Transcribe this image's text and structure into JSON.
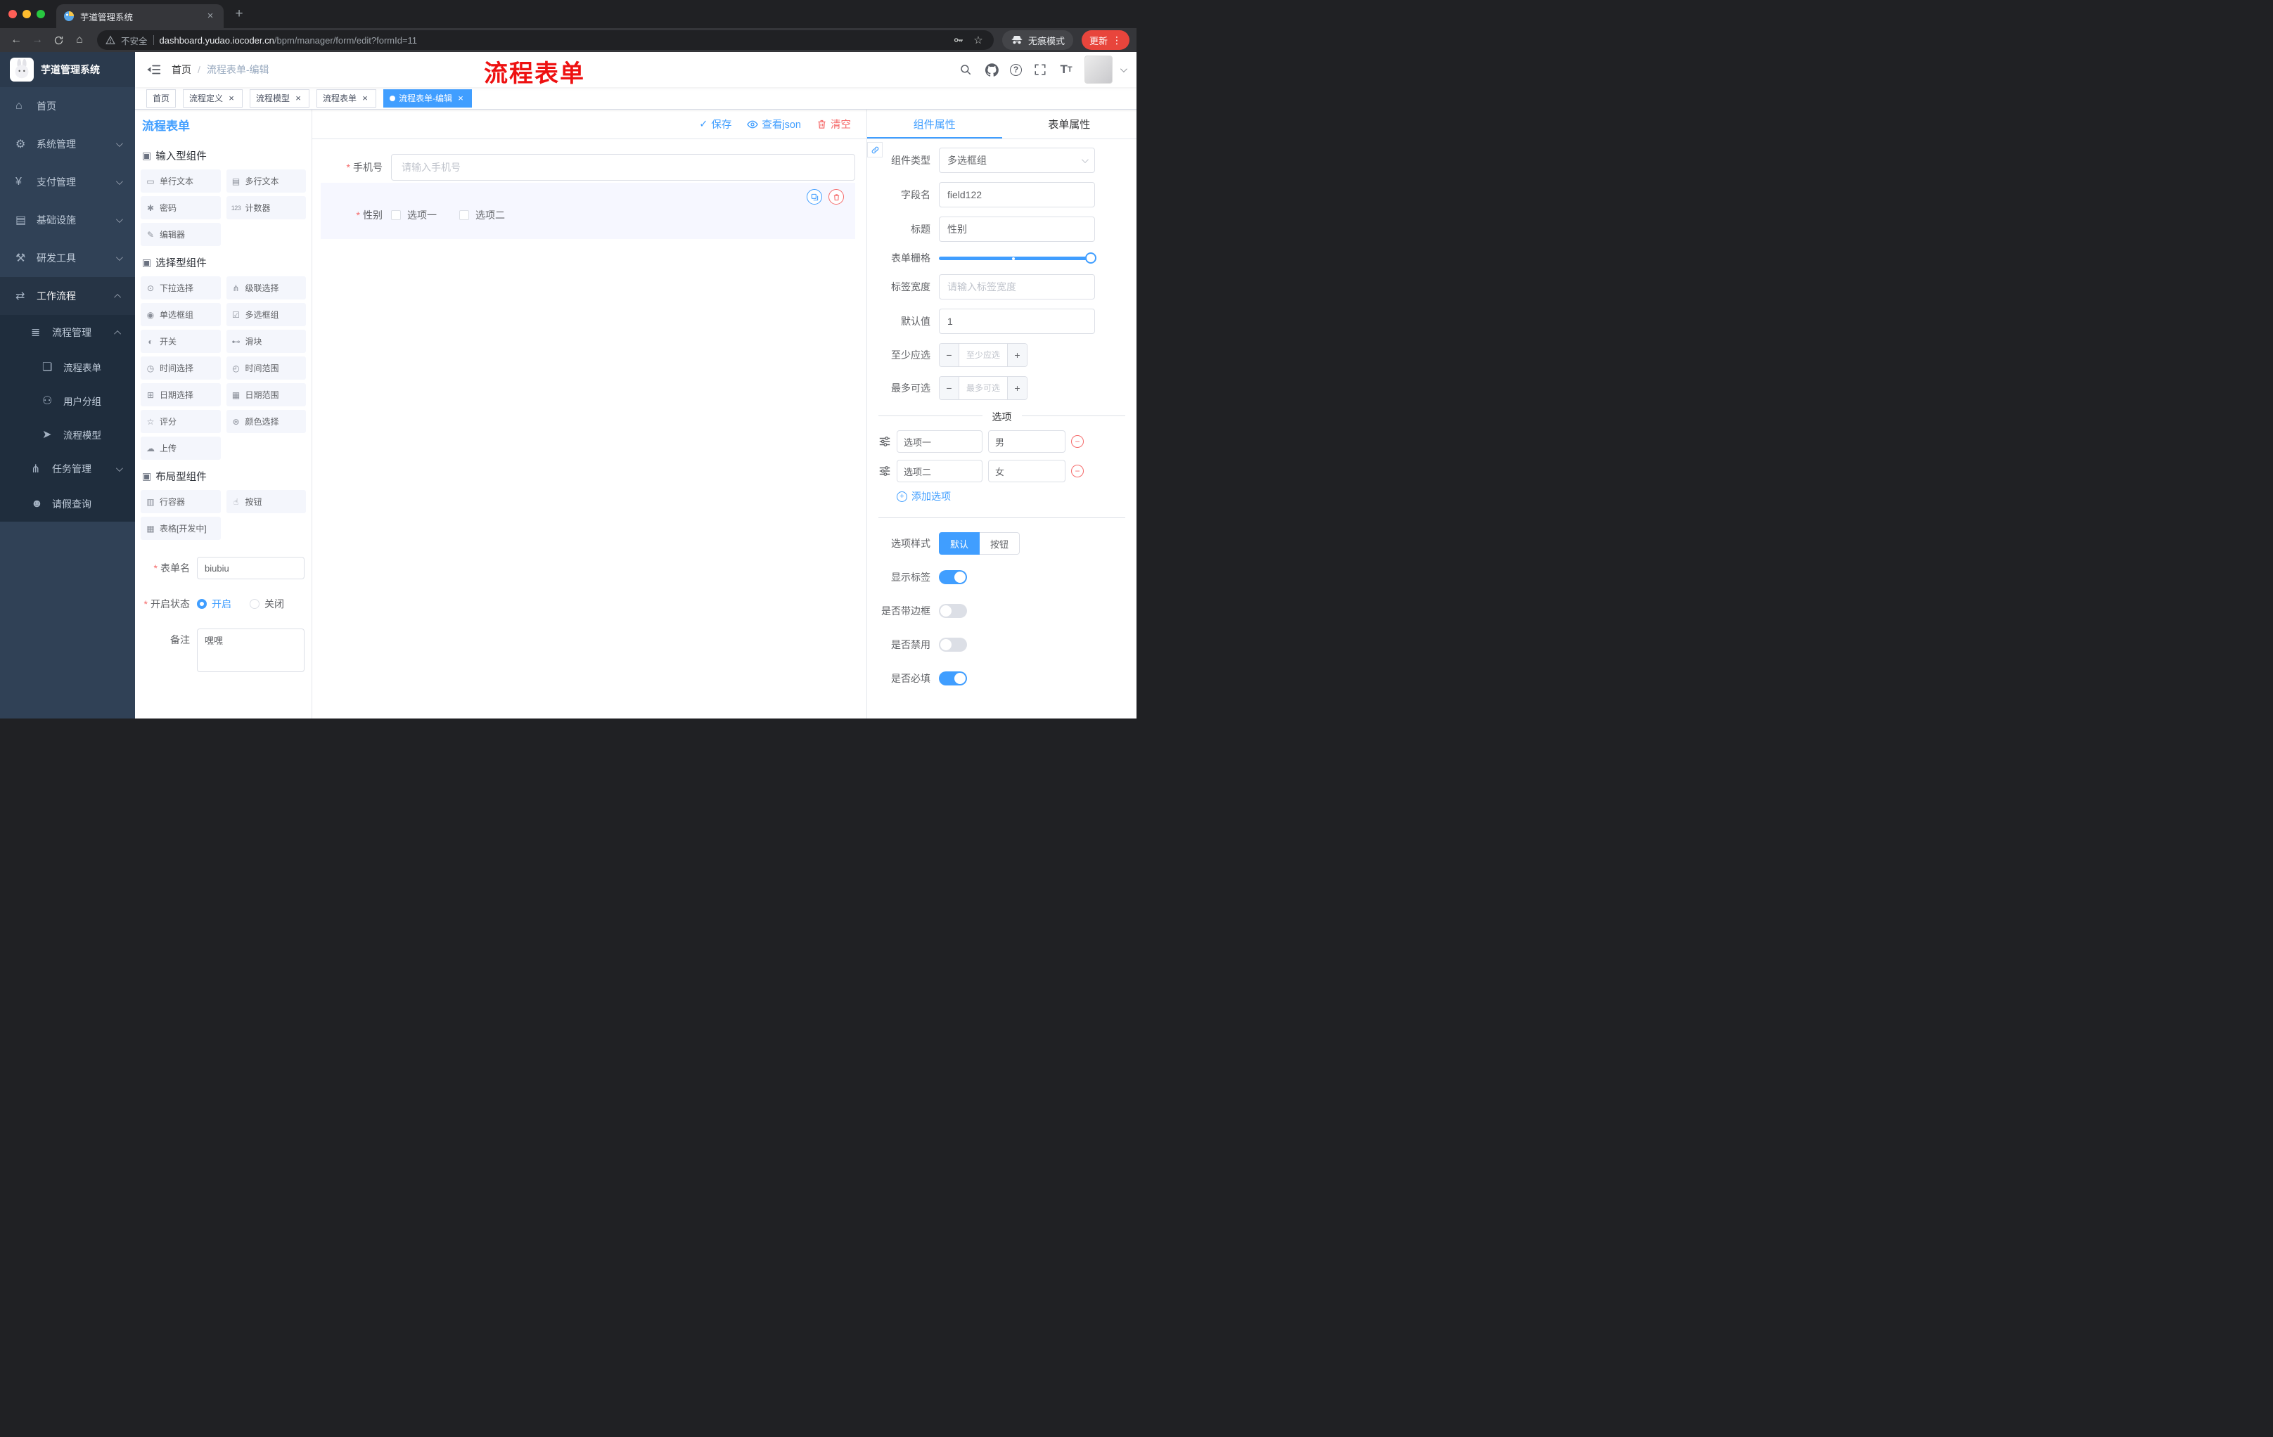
{
  "colors": {
    "accent": "#409eff",
    "danger": "#f56c6c",
    "sidebar_bg": "#304156",
    "sidebar_submenu_bg": "#1f2d3d",
    "chrome_bg": "#202124",
    "chrome_bar_bg": "#35363a",
    "update_button_red": "#e8453c",
    "selected_widget_bg": "#f6f7ff"
  },
  "icons": {
    "check": "✓",
    "close": "×",
    "plus": "+",
    "minus": "−",
    "kebab": "⋮",
    "back": "←",
    "forward": "→",
    "home": "⌂",
    "question": "?",
    "font_size": "T",
    "star": "☆",
    "slash": "/"
  },
  "browser": {
    "tab_title": "芋道管理系统",
    "security_label": "不安全",
    "url_domain": "dashboard.yudao.iocoder.cn",
    "url_path": "/bpm/manager/form/edit?formId=11",
    "incognito_label": "无痕模式",
    "update_label": "更新"
  },
  "sidebar": {
    "logo_title": "芋道管理系统",
    "items": [
      {
        "label": "首页",
        "icon": "⌂"
      },
      {
        "label": "系统管理",
        "icon": "⚙"
      },
      {
        "label": "支付管理",
        "icon": "¥"
      },
      {
        "label": "基础设施",
        "icon": "▤"
      },
      {
        "label": "研发工具",
        "icon": "⚒"
      },
      {
        "label": "工作流程",
        "icon": "⇄"
      }
    ],
    "workflow": {
      "process_mgmt": {
        "label": "流程管理",
        "icon": "≣"
      },
      "children": [
        {
          "label": "流程表单",
          "icon": "❏"
        },
        {
          "label": "用户分组",
          "icon": "⚇"
        },
        {
          "label": "流程模型",
          "icon": "➤"
        }
      ],
      "task_mgmt": {
        "label": "任务管理",
        "icon": "⋔"
      },
      "leave_query": {
        "label": "请假查询",
        "icon": "☻"
      }
    }
  },
  "header": {
    "breadcrumb": [
      "首页",
      "流程表单-编辑"
    ],
    "annotation": "流程表单"
  },
  "tags": [
    {
      "label": "首页",
      "closable": false,
      "active": false
    },
    {
      "label": "流程定义",
      "closable": true,
      "active": false
    },
    {
      "label": "流程模型",
      "closable": true,
      "active": false
    },
    {
      "label": "流程表单",
      "closable": true,
      "active": false
    },
    {
      "label": "流程表单-编辑",
      "closable": true,
      "active": true
    }
  ],
  "designer": {
    "title": "流程表单",
    "actions": {
      "save": "保存",
      "view_json": "查看json",
      "clear": "清空"
    }
  },
  "palette": {
    "sections": [
      {
        "title": "输入型组件",
        "icon": "▣",
        "items": [
          {
            "label": "单行文本",
            "icon": "▭"
          },
          {
            "label": "多行文本",
            "icon": "▤"
          },
          {
            "label": "密码",
            "icon": "✱"
          },
          {
            "label": "计数器",
            "icon": "123"
          },
          {
            "label": "编辑器",
            "icon": "✎"
          }
        ]
      },
      {
        "title": "选择型组件",
        "icon": "▣",
        "items": [
          {
            "label": "下拉选择",
            "icon": "⊙"
          },
          {
            "label": "级联选择",
            "icon": "⋔"
          },
          {
            "label": "单选框组",
            "icon": "◉"
          },
          {
            "label": "多选框组",
            "icon": "☑"
          },
          {
            "label": "开关",
            "icon": "◐"
          },
          {
            "label": "滑块",
            "icon": "⊷"
          },
          {
            "label": "时间选择",
            "icon": "◷"
          },
          {
            "label": "时间范围",
            "icon": "◴"
          },
          {
            "label": "日期选择",
            "icon": "⊞"
          },
          {
            "label": "日期范围",
            "icon": "▦"
          },
          {
            "label": "评分",
            "icon": "☆"
          },
          {
            "label": "颜色选择",
            "icon": "⊛"
          },
          {
            "label": "上传",
            "icon": "☁"
          }
        ]
      },
      {
        "title": "布局型组件",
        "icon": "▣",
        "items": [
          {
            "label": "行容器",
            "icon": "▥"
          },
          {
            "label": "按钮",
            "icon": "☝"
          },
          {
            "label": "表格[开发中]",
            "icon": "▦"
          }
        ]
      }
    ]
  },
  "meta_form": {
    "name_label": "表单名",
    "name_value": "biubiu",
    "status_label": "开启状态",
    "status_options": [
      "开启",
      "关闭"
    ],
    "status_selected": "开启",
    "remark_label": "备注",
    "remark_value": "嘿嘿"
  },
  "canvas": {
    "phone": {
      "label": "手机号",
      "placeholder": "请输入手机号",
      "required": true
    },
    "gender": {
      "label": "性别",
      "required": true,
      "options": [
        "选项一",
        "选项二"
      ]
    }
  },
  "props": {
    "tabs": {
      "component": "组件属性",
      "form": "表单属性"
    },
    "component_type_label": "组件类型",
    "component_type_value": "多选框组",
    "field_name_label": "字段名",
    "field_name_value": "field122",
    "title_label": "标题",
    "title_value": "性别",
    "grid_label": "表单栅格",
    "label_width_label": "标签宽度",
    "label_width_placeholder": "请输入标签宽度",
    "default_label": "默认值",
    "default_value": "1",
    "min_label": "至少应选",
    "min_placeholder": "至少应选",
    "max_label": "最多可选",
    "max_placeholder": "最多可选",
    "options_title": "选项",
    "options": [
      {
        "label": "选项一",
        "value": "男"
      },
      {
        "label": "选项二",
        "value": "女"
      }
    ],
    "add_option": "添加选项",
    "option_style_label": "选项样式",
    "option_style_values": [
      "默认",
      "按钮"
    ],
    "option_style_selected": "默认",
    "toggles": [
      {
        "label": "显示标签",
        "on": true
      },
      {
        "label": "是否带边框",
        "on": false
      },
      {
        "label": "是否禁用",
        "on": false
      },
      {
        "label": "是否必填",
        "on": true
      }
    ]
  }
}
